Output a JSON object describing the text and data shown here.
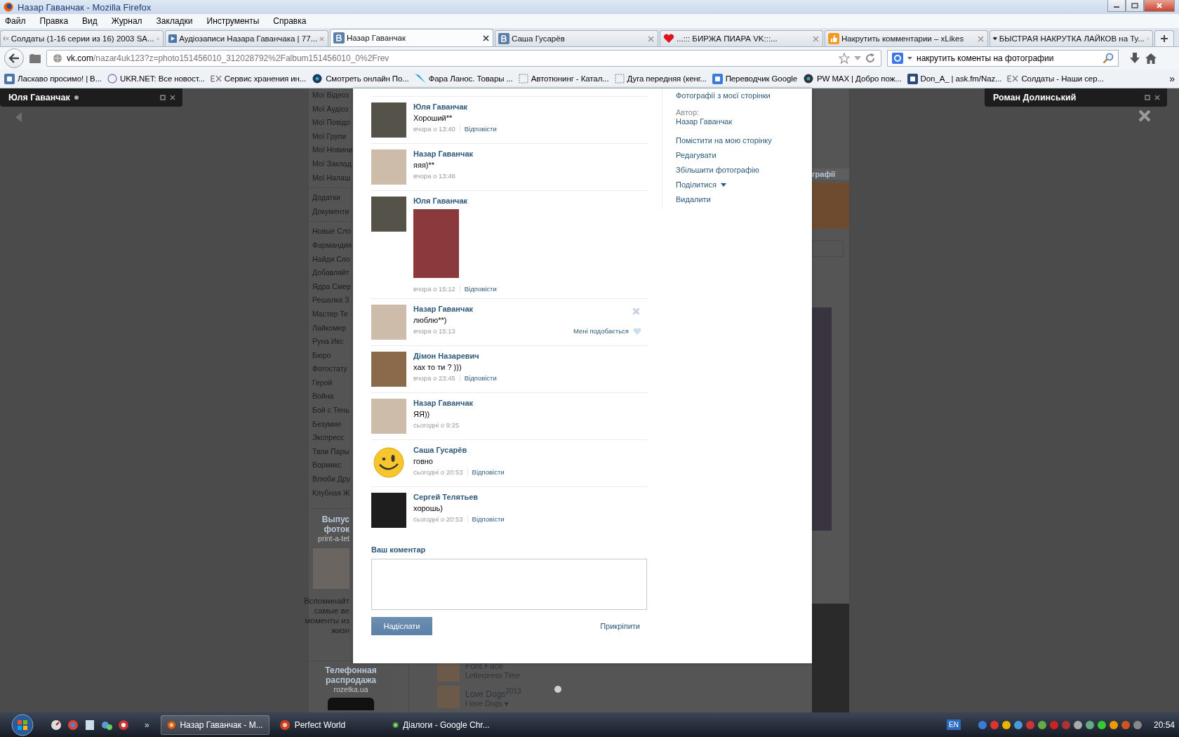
{
  "window": {
    "title": "Назар Гаванчак - Mozilla Firefox"
  },
  "menu": [
    "Файл",
    "Правка",
    "Вид",
    "Журнал",
    "Закладки",
    "Инструменты",
    "Справка"
  ],
  "tabs": [
    {
      "label": "Солдаты (1-16 серии из 16) 2003 SA...",
      "kind": "ex",
      "selected": false
    },
    {
      "label": "Аудіозаписи Назара Гаванчака | 77...",
      "kind": "play",
      "selected": false
    },
    {
      "label": "Назар Гаванчак",
      "kind": "vk",
      "selected": true
    },
    {
      "label": "Саша Гусарёв",
      "kind": "vk",
      "selected": false
    },
    {
      "label": "...::: БИРЖА ПИАРА VK:::...",
      "kind": "heart",
      "selected": false
    },
    {
      "label": "Накрутить комментарии – xLikes",
      "kind": "thumb",
      "selected": false
    },
    {
      "label": "БЫСТРАЯ НАКРУТКА ЛАЙКОВ на Ту...",
      "kind": "blackheart",
      "selected": false
    }
  ],
  "address": {
    "host": "vk.com",
    "path": "/nazar4uk123?z=photo151456010_312028792%2Falbum151456010_0%2Frev"
  },
  "search": {
    "value": "накрутить коменты на фотографии"
  },
  "bookmarks": {
    "items": [
      {
        "label": "Ласкаво просимо! | В...",
        "kind": "vk"
      },
      {
        "label": "UKR.NET: Все новост...",
        "kind": "ukr"
      },
      {
        "label": "Сервис хранения ин...",
        "kind": "ex"
      },
      {
        "label": "Смотреть онлайн По...",
        "kind": "eye"
      },
      {
        "label": "Фара Ланос. Товары ...",
        "kind": "bird"
      },
      {
        "label": "Автотюнинг - Катал...",
        "kind": "blank"
      },
      {
        "label": "Дуга передняя (кенг...",
        "kind": "blank"
      },
      {
        "label": "Переводчик Google",
        "kind": "translate"
      },
      {
        "label": "PW MAX | Добро пож...",
        "kind": "globe"
      },
      {
        "label": "Don_A_ | ask.fm/Naz...",
        "kind": "askfm"
      },
      {
        "label": "Солдаты - Наши сер...",
        "kind": "ex"
      }
    ],
    "overflow": "»"
  },
  "chats": [
    {
      "name": "Юля Гаванчак",
      "online": true
    },
    {
      "name": "Роман Долинський",
      "online": false
    }
  ],
  "sidebar": {
    "groups": [
      [
        "Мої Відеоз",
        "Мої Аудіоз",
        "Мої Повідо",
        "Мої Групи",
        "Мої Новини",
        "Мої Заклад",
        "Мої Налаш"
      ],
      [
        "Додатки",
        "Документи"
      ],
      [
        "Новые Сло",
        "Фармандия",
        "Найди Сло",
        "Добавляйт",
        "Ядра Смер",
        "Решалка З",
        "Мастер Те",
        "Лайкомер",
        "Руна Икс",
        "Бюро",
        "Фотостату",
        "Герой",
        "Война",
        "Бой с Тень",
        "Безумие",
        "Экспресс",
        "Твои Пары",
        "Вормикс",
        "Влюби Дру",
        "Клубная Ж"
      ]
    ],
    "ads": [
      {
        "title": [
          "Выпус",
          "фоток"
        ],
        "site": "print-a-tet",
        "photo": true,
        "text": [
          "Вспоминайт",
          "самые ве",
          "моменты из",
          "жизн"
        ]
      },
      {
        "title": [
          "Телефонная",
          "распродажа"
        ],
        "site": "rozetka.ua",
        "photo": false
      }
    ]
  },
  "background": {
    "tab": "графії",
    "apps": [
      {
        "title": "Font Face",
        "subtitle": "Letterpress Time"
      },
      {
        "title": "Love Dogs$^{2013}$",
        "subtitle": "I love Dogs ♥"
      }
    ]
  },
  "comments": [
    {
      "author": "Юля Гаванчак",
      "kind": "wolf",
      "text": "Хороший**",
      "time": "вчора о 13:40",
      "reply": "Відповісти"
    },
    {
      "author": "Назар Гаванчак",
      "kind": "baby",
      "text": "яяя)**",
      "time": "вчора о 13:48"
    },
    {
      "author": "Юля Гаванчак",
      "kind": "wolf",
      "photo": true,
      "time": "вчора о 15:12",
      "reply": "Відповісти"
    },
    {
      "author": "Назар Гаванчак",
      "kind": "baby",
      "text": "люблю**)",
      "time": "вчора о 15:13",
      "like": "Мені подобається",
      "delete_button": true
    },
    {
      "author": "Дімон Назаревич",
      "kind": "husky",
      "text": "хах то ти ? )))",
      "time": "вчора о 23:45",
      "reply": "Відповісти"
    },
    {
      "author": "Назар Гаванчак",
      "kind": "baby",
      "text": "ЯЯ))",
      "time": "сьогодні о 9:25"
    },
    {
      "author": "Саша Гусарёв",
      "kind": "smiley",
      "text": "говно",
      "time": "сьогодні о 20:53",
      "reply": "Відповісти"
    },
    {
      "author": "Сергей Телятьев",
      "kind": "dark",
      "text": "хорошь)",
      "time": "сьогодні о 20:53",
      "reply": "Відповісти"
    }
  ],
  "comment_form": {
    "label": "Ваш коментар",
    "submit": "Надіслати",
    "attach": "Прикріпити"
  },
  "photo_panel": {
    "album": "Фотографії з моєї сторінки",
    "author_label": "Автор:",
    "author": "Назар Гаванчак",
    "actions": [
      {
        "label": "Помістити на мою сторінку",
        "dropdown": false
      },
      {
        "label": "Редагувати",
        "dropdown": false
      },
      {
        "label": "Збільшити фотографію",
        "dropdown": false
      },
      {
        "label": "Поділитися",
        "dropdown": true
      },
      {
        "label": "Видалити",
        "dropdown": false
      }
    ]
  },
  "taskbar": {
    "more": "»",
    "tasks": [
      {
        "label": "Назар Гаванчак - М...",
        "kind": "firefox",
        "selected": true
      },
      {
        "label": "Perfect World",
        "kind": "pw",
        "selected": false
      },
      {
        "label": "Діалоги - Google Chr...",
        "kind": "chrome",
        "selected": false
      }
    ],
    "language": "EN",
    "clock": "20:54"
  }
}
